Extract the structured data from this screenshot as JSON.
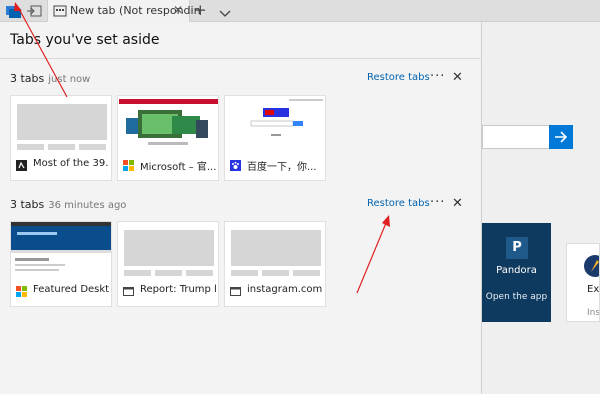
{
  "browser": {
    "tab": {
      "title": "New tab (Not respondin"
    },
    "close_glyph": "✕",
    "newtab_glyph": "+"
  },
  "panel": {
    "title": "Tabs you've set aside",
    "more_glyph": "···",
    "close_glyph": "✕",
    "groups": [
      {
        "count": "3 tabs",
        "time": "just now",
        "restore_label": "Restore tabs",
        "tabs": [
          {
            "label": "Most of the 39..."
          },
          {
            "label": "Microsoft – 官..."
          },
          {
            "label": "百度一下，你..."
          }
        ]
      },
      {
        "count": "3 tabs",
        "time": "36 minutes ago",
        "restore_label": "Restore tabs",
        "tabs": [
          {
            "label": "Featured Deskt..."
          },
          {
            "label": "Report: Trump l..."
          },
          {
            "label": "instagram.com"
          }
        ]
      }
    ]
  },
  "background": {
    "pandora": {
      "logo": "P",
      "name": "Pandora",
      "action": "Open the app"
    },
    "explore": {
      "name": "Exp",
      "sub": "Insta"
    }
  },
  "colors": {
    "accent": "#0078d7",
    "link": "#0063b1",
    "annotation": "#e02020"
  }
}
